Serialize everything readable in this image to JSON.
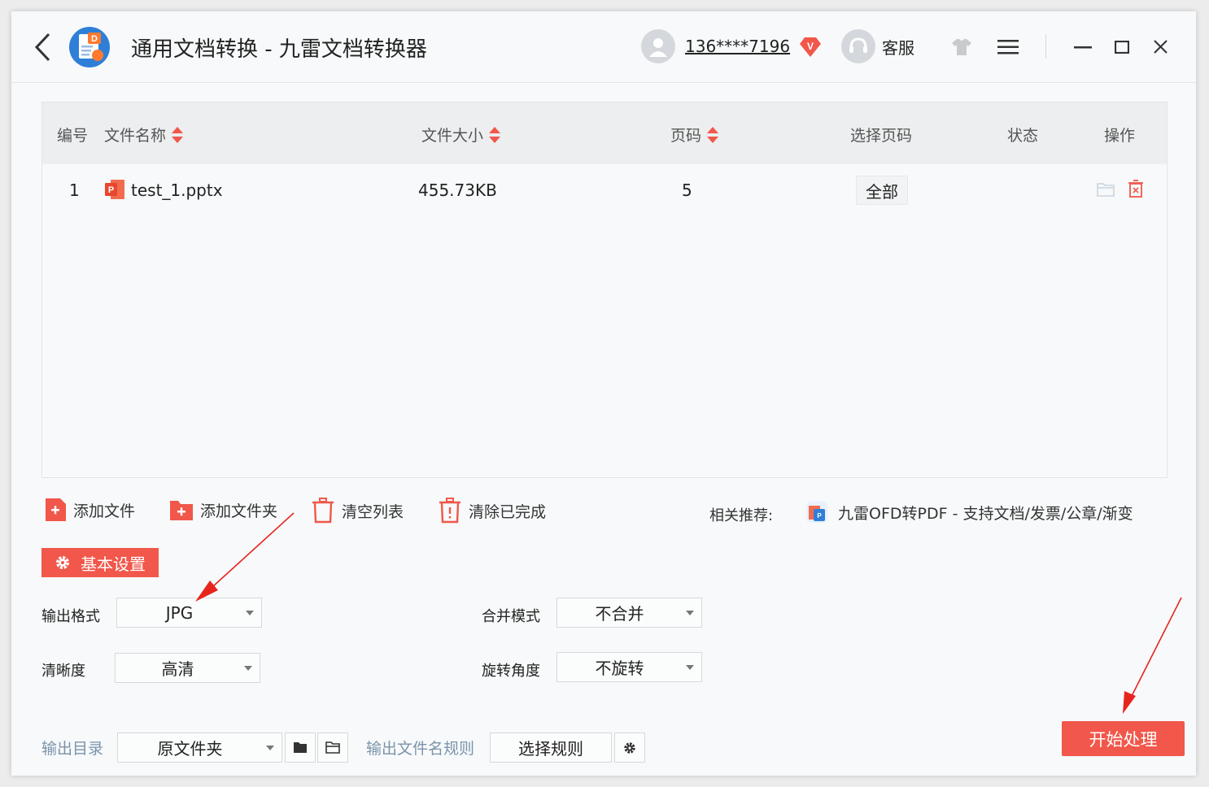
{
  "window": {
    "title": "通用文档转换 - 九雷文档转换器",
    "user": {
      "phone": "136****7196",
      "vip_badge": "V"
    },
    "service_label": "客服",
    "icons": [
      "back-icon",
      "app-logo-icon",
      "avatar-icon",
      "vip-icon",
      "headset-icon",
      "skin-icon",
      "menu-icon",
      "minimize-icon",
      "maximize-icon",
      "close-icon"
    ]
  },
  "table": {
    "headers": {
      "index": "编号",
      "name": "文件名称",
      "size": "文件大小",
      "pages": "页码",
      "select_pages": "选择页码",
      "status": "状态",
      "actions": "操作"
    },
    "rows": [
      {
        "index": "1",
        "name": "test_1.pptx",
        "size": "455.73KB",
        "pages": "5",
        "select_pages": "全部",
        "status": ""
      }
    ]
  },
  "toolbar": {
    "add_file": "添加文件",
    "add_folder": "添加文件夹",
    "clear_list": "清空列表",
    "clear_done": "清除已完成",
    "recommend_label": "相关推荐:",
    "recommend_text": "九雷OFD转PDF - 支持文档/发票/公章/渐变"
  },
  "settings": {
    "button": "基本设置",
    "output_format": {
      "label": "输出格式",
      "value": "JPG"
    },
    "merge_mode": {
      "label": "合并模式",
      "value": "不合并"
    },
    "clarity": {
      "label": "清晰度",
      "value": "高清"
    },
    "rotation": {
      "label": "旋转角度",
      "value": "不旋转"
    },
    "output_dir": {
      "label": "输出目录",
      "value": "原文件夹"
    },
    "filename_rule": {
      "label": "输出文件名规则",
      "button": "选择规则"
    },
    "start": "开始处理"
  },
  "colors": {
    "accent": "#f1574a",
    "link": "#7b93aa",
    "header_bg": "#eceeef"
  }
}
